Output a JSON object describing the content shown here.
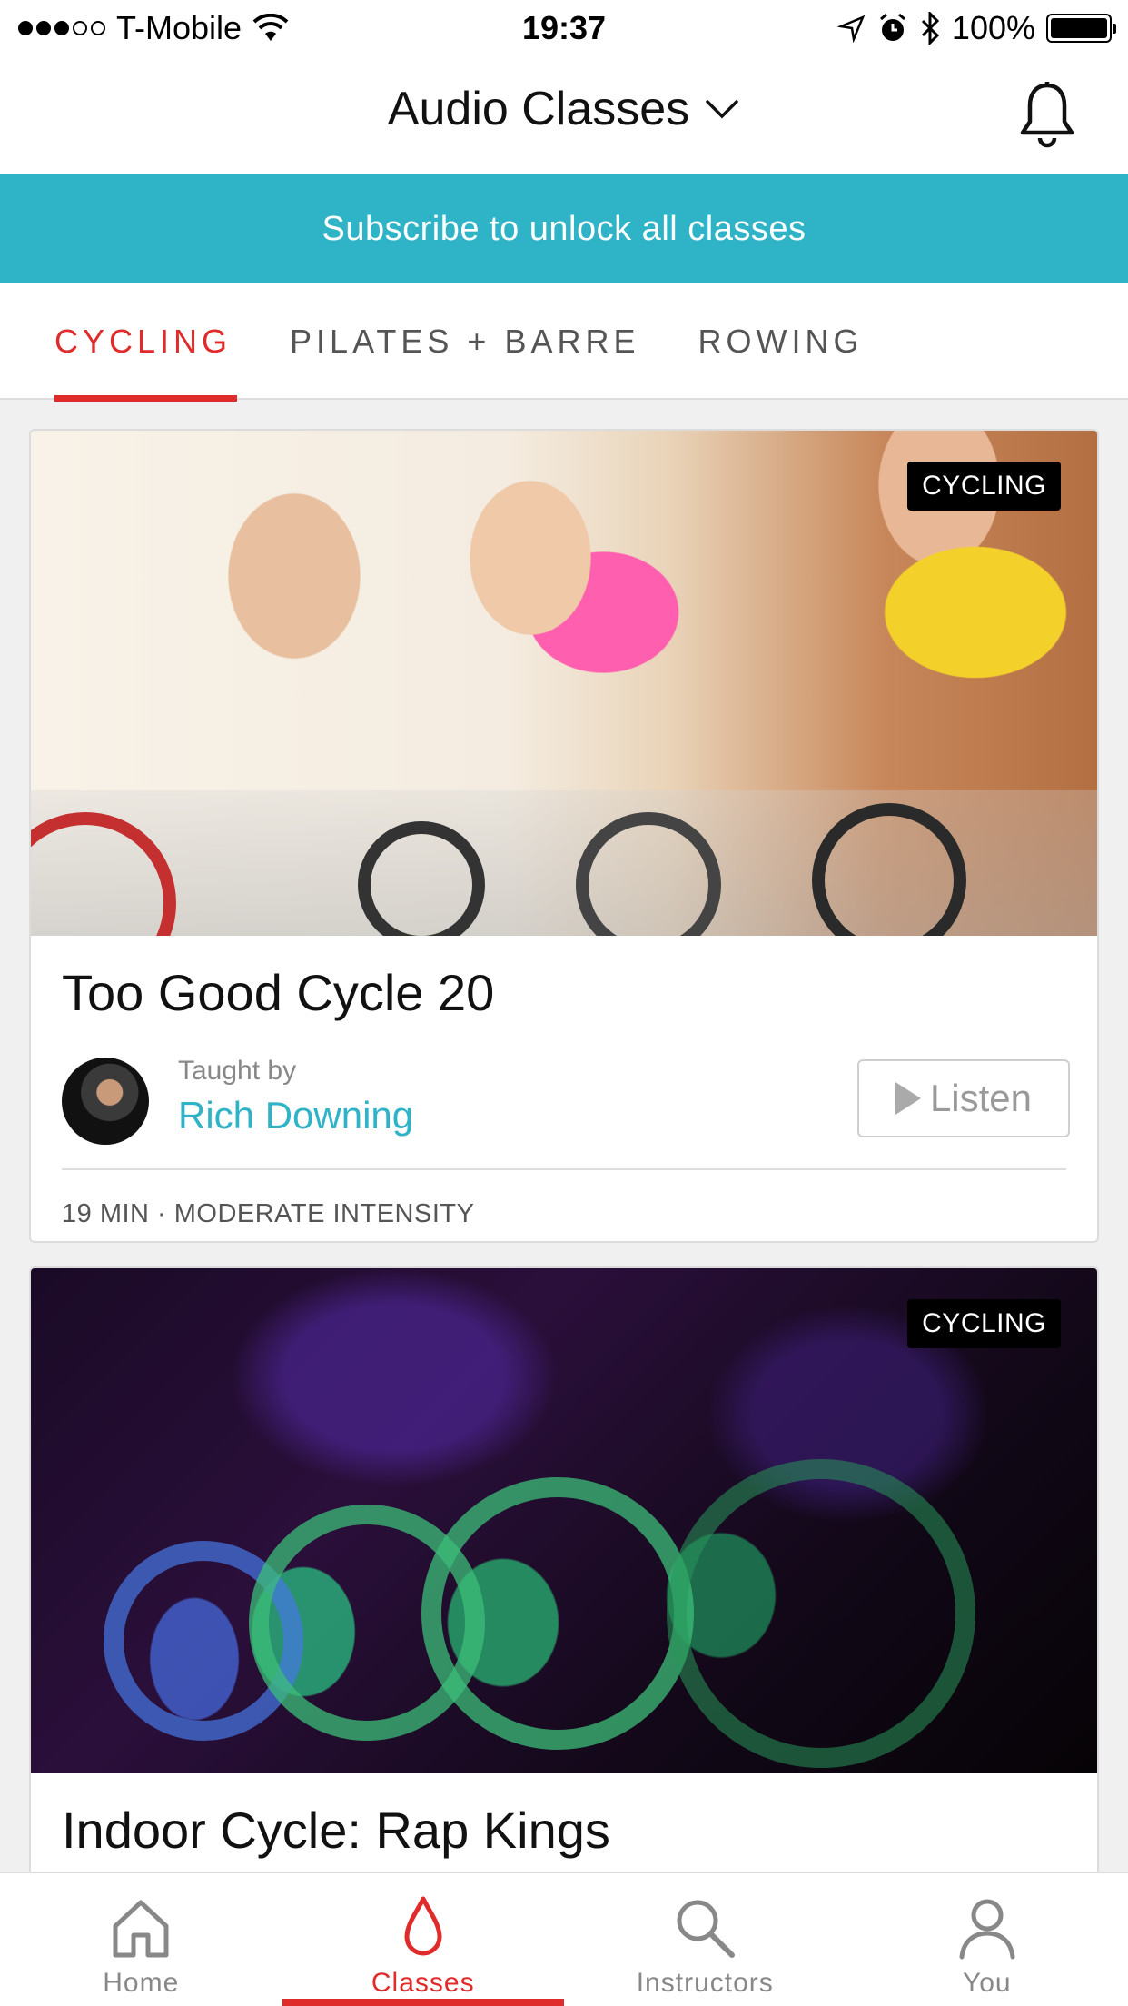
{
  "status_bar": {
    "carrier": "T-Mobile",
    "time": "19:37",
    "battery": "100%",
    "signal_bars_filled": 3,
    "signal_bars_total": 5
  },
  "header": {
    "title": "Audio Classes"
  },
  "banner": {
    "text": "Subscribe to unlock all classes"
  },
  "tabs": [
    {
      "label": "CYCLING",
      "active": true
    },
    {
      "label": "PILATES + BARRE",
      "active": false
    },
    {
      "label": "ROWING",
      "active": false
    }
  ],
  "cards": [
    {
      "badge": "CYCLING",
      "title": "Too Good Cycle 20",
      "taught_by_label": "Taught by",
      "instructor": "Rich Downing",
      "listen_label": "Listen",
      "meta": "19 MIN · MODERATE INTENSITY"
    },
    {
      "badge": "CYCLING",
      "title": "Indoor Cycle: Rap Kings"
    }
  ],
  "bottom_nav": [
    {
      "label": "Home",
      "icon": "home-icon",
      "active": false
    },
    {
      "label": "Classes",
      "icon": "drop-icon",
      "active": true
    },
    {
      "label": "Instructors",
      "icon": "search-icon",
      "active": false
    },
    {
      "label": "You",
      "icon": "person-icon",
      "active": false
    }
  ],
  "colors": {
    "accent_red": "#e02b2b",
    "accent_teal": "#2fb3c6"
  }
}
